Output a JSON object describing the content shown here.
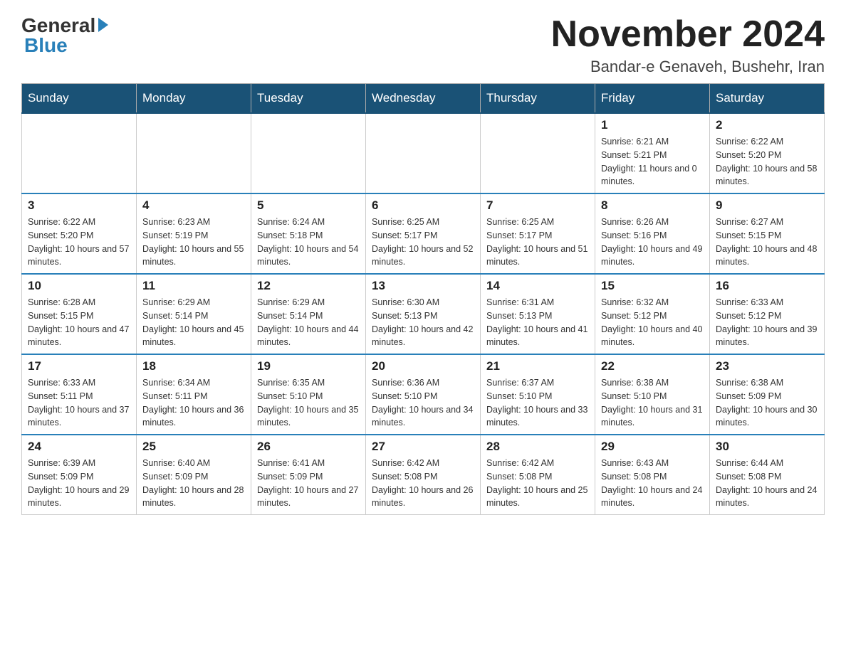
{
  "header": {
    "logo_general": "General",
    "logo_blue": "Blue",
    "month_title": "November 2024",
    "location": "Bandar-e Genaveh, Bushehr, Iran"
  },
  "days_of_week": [
    "Sunday",
    "Monday",
    "Tuesday",
    "Wednesday",
    "Thursday",
    "Friday",
    "Saturday"
  ],
  "weeks": [
    [
      {
        "day": "",
        "sunrise": "",
        "sunset": "",
        "daylight": ""
      },
      {
        "day": "",
        "sunrise": "",
        "sunset": "",
        "daylight": ""
      },
      {
        "day": "",
        "sunrise": "",
        "sunset": "",
        "daylight": ""
      },
      {
        "day": "",
        "sunrise": "",
        "sunset": "",
        "daylight": ""
      },
      {
        "day": "",
        "sunrise": "",
        "sunset": "",
        "daylight": ""
      },
      {
        "day": "1",
        "sunrise": "Sunrise: 6:21 AM",
        "sunset": "Sunset: 5:21 PM",
        "daylight": "Daylight: 11 hours and 0 minutes."
      },
      {
        "day": "2",
        "sunrise": "Sunrise: 6:22 AM",
        "sunset": "Sunset: 5:20 PM",
        "daylight": "Daylight: 10 hours and 58 minutes."
      }
    ],
    [
      {
        "day": "3",
        "sunrise": "Sunrise: 6:22 AM",
        "sunset": "Sunset: 5:20 PM",
        "daylight": "Daylight: 10 hours and 57 minutes."
      },
      {
        "day": "4",
        "sunrise": "Sunrise: 6:23 AM",
        "sunset": "Sunset: 5:19 PM",
        "daylight": "Daylight: 10 hours and 55 minutes."
      },
      {
        "day": "5",
        "sunrise": "Sunrise: 6:24 AM",
        "sunset": "Sunset: 5:18 PM",
        "daylight": "Daylight: 10 hours and 54 minutes."
      },
      {
        "day": "6",
        "sunrise": "Sunrise: 6:25 AM",
        "sunset": "Sunset: 5:17 PM",
        "daylight": "Daylight: 10 hours and 52 minutes."
      },
      {
        "day": "7",
        "sunrise": "Sunrise: 6:25 AM",
        "sunset": "Sunset: 5:17 PM",
        "daylight": "Daylight: 10 hours and 51 minutes."
      },
      {
        "day": "8",
        "sunrise": "Sunrise: 6:26 AM",
        "sunset": "Sunset: 5:16 PM",
        "daylight": "Daylight: 10 hours and 49 minutes."
      },
      {
        "day": "9",
        "sunrise": "Sunrise: 6:27 AM",
        "sunset": "Sunset: 5:15 PM",
        "daylight": "Daylight: 10 hours and 48 minutes."
      }
    ],
    [
      {
        "day": "10",
        "sunrise": "Sunrise: 6:28 AM",
        "sunset": "Sunset: 5:15 PM",
        "daylight": "Daylight: 10 hours and 47 minutes."
      },
      {
        "day": "11",
        "sunrise": "Sunrise: 6:29 AM",
        "sunset": "Sunset: 5:14 PM",
        "daylight": "Daylight: 10 hours and 45 minutes."
      },
      {
        "day": "12",
        "sunrise": "Sunrise: 6:29 AM",
        "sunset": "Sunset: 5:14 PM",
        "daylight": "Daylight: 10 hours and 44 minutes."
      },
      {
        "day": "13",
        "sunrise": "Sunrise: 6:30 AM",
        "sunset": "Sunset: 5:13 PM",
        "daylight": "Daylight: 10 hours and 42 minutes."
      },
      {
        "day": "14",
        "sunrise": "Sunrise: 6:31 AM",
        "sunset": "Sunset: 5:13 PM",
        "daylight": "Daylight: 10 hours and 41 minutes."
      },
      {
        "day": "15",
        "sunrise": "Sunrise: 6:32 AM",
        "sunset": "Sunset: 5:12 PM",
        "daylight": "Daylight: 10 hours and 40 minutes."
      },
      {
        "day": "16",
        "sunrise": "Sunrise: 6:33 AM",
        "sunset": "Sunset: 5:12 PM",
        "daylight": "Daylight: 10 hours and 39 minutes."
      }
    ],
    [
      {
        "day": "17",
        "sunrise": "Sunrise: 6:33 AM",
        "sunset": "Sunset: 5:11 PM",
        "daylight": "Daylight: 10 hours and 37 minutes."
      },
      {
        "day": "18",
        "sunrise": "Sunrise: 6:34 AM",
        "sunset": "Sunset: 5:11 PM",
        "daylight": "Daylight: 10 hours and 36 minutes."
      },
      {
        "day": "19",
        "sunrise": "Sunrise: 6:35 AM",
        "sunset": "Sunset: 5:10 PM",
        "daylight": "Daylight: 10 hours and 35 minutes."
      },
      {
        "day": "20",
        "sunrise": "Sunrise: 6:36 AM",
        "sunset": "Sunset: 5:10 PM",
        "daylight": "Daylight: 10 hours and 34 minutes."
      },
      {
        "day": "21",
        "sunrise": "Sunrise: 6:37 AM",
        "sunset": "Sunset: 5:10 PM",
        "daylight": "Daylight: 10 hours and 33 minutes."
      },
      {
        "day": "22",
        "sunrise": "Sunrise: 6:38 AM",
        "sunset": "Sunset: 5:10 PM",
        "daylight": "Daylight: 10 hours and 31 minutes."
      },
      {
        "day": "23",
        "sunrise": "Sunrise: 6:38 AM",
        "sunset": "Sunset: 5:09 PM",
        "daylight": "Daylight: 10 hours and 30 minutes."
      }
    ],
    [
      {
        "day": "24",
        "sunrise": "Sunrise: 6:39 AM",
        "sunset": "Sunset: 5:09 PM",
        "daylight": "Daylight: 10 hours and 29 minutes."
      },
      {
        "day": "25",
        "sunrise": "Sunrise: 6:40 AM",
        "sunset": "Sunset: 5:09 PM",
        "daylight": "Daylight: 10 hours and 28 minutes."
      },
      {
        "day": "26",
        "sunrise": "Sunrise: 6:41 AM",
        "sunset": "Sunset: 5:09 PM",
        "daylight": "Daylight: 10 hours and 27 minutes."
      },
      {
        "day": "27",
        "sunrise": "Sunrise: 6:42 AM",
        "sunset": "Sunset: 5:08 PM",
        "daylight": "Daylight: 10 hours and 26 minutes."
      },
      {
        "day": "28",
        "sunrise": "Sunrise: 6:42 AM",
        "sunset": "Sunset: 5:08 PM",
        "daylight": "Daylight: 10 hours and 25 minutes."
      },
      {
        "day": "29",
        "sunrise": "Sunrise: 6:43 AM",
        "sunset": "Sunset: 5:08 PM",
        "daylight": "Daylight: 10 hours and 24 minutes."
      },
      {
        "day": "30",
        "sunrise": "Sunrise: 6:44 AM",
        "sunset": "Sunset: 5:08 PM",
        "daylight": "Daylight: 10 hours and 24 minutes."
      }
    ]
  ]
}
